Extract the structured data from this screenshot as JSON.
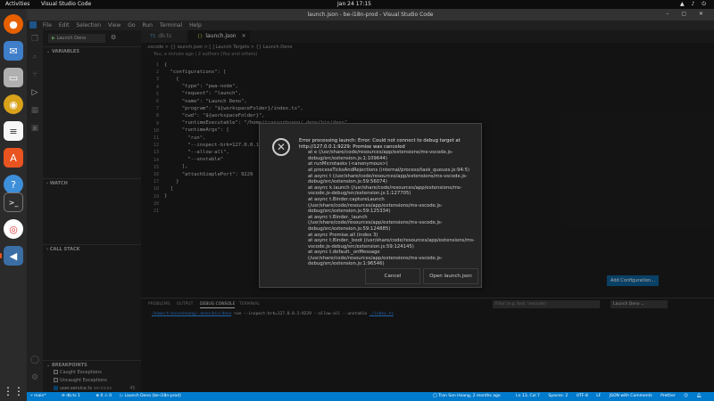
{
  "os": {
    "activities": "Activities",
    "app_name": "Visual Studio Code",
    "clock": "Jan 24  17:15"
  },
  "window": {
    "title": "launch.json - be-i18n-prod - Visual Studio Code"
  },
  "menu": [
    "File",
    "Edit",
    "Selection",
    "View",
    "Go",
    "Run",
    "Terminal",
    "Help"
  ],
  "sidebar": {
    "run_config": "Launch Deno",
    "sections": {
      "variables": "VARIABLES",
      "watch": "WATCH",
      "call_stack": "CALL STACK",
      "breakpoints": "BREAKPOINTS"
    },
    "breakpoints": [
      {
        "label": "Caught Exceptions",
        "checked": false
      },
      {
        "label": "Uncaught Exceptions",
        "checked": false
      },
      {
        "label": "user.service.ts",
        "detail": "services",
        "count": "45",
        "checked": true
      }
    ]
  },
  "tabs": [
    {
      "label": "db.ts",
      "active": false
    },
    {
      "label": "launch.json",
      "active": true
    }
  ],
  "breadcrumb": ".vscode  >  {} launch.json  >  [ ] Launch Targets  >  {} Launch Deno",
  "blame": "You, a minute ago | 2 authors (You and others)",
  "code_lines": [
    {
      "n": "1",
      "t": "{"
    },
    {
      "n": "2",
      "t": "  \"configurations\": ["
    },
    {
      "n": "3",
      "t": "    {"
    },
    {
      "n": "4",
      "t": "      \"type\": \"pwa-node\","
    },
    {
      "n": "5",
      "t": "      \"request\": \"launch\","
    },
    {
      "n": "6",
      "t": "      \"name\": \"Launch Deno\","
    },
    {
      "n": "7",
      "t": "      \"program\": \"${workspaceFolder}/index.ts\","
    },
    {
      "n": "8",
      "t": "      \"cwd\": \"${workspaceFolder}\","
    },
    {
      "n": "9",
      "t": "      \"runtimeExecutable\": \"/home/transonhoang/.deno/bin/deno\","
    },
    {
      "n": "10",
      "t": "      \"runtimeArgs\": ["
    },
    {
      "n": "11",
      "t": "        \"run\","
    },
    {
      "n": "12",
      "t": "        \"--inspect-brk=127.0.0.1:9229\","
    },
    {
      "n": "13",
      "t": "        \"--allow-all\","
    },
    {
      "n": "14",
      "t": "        \"--unstable\""
    },
    {
      "n": "15",
      "t": "      ],"
    },
    {
      "n": "16",
      "t": "      \"attachSimplePort\": 9229"
    },
    {
      "n": "17",
      "t": "    }"
    },
    {
      "n": "18",
      "t": "  ]"
    },
    {
      "n": "19",
      "t": "}"
    },
    {
      "n": "20",
      "t": ""
    },
    {
      "n": "21",
      "t": ""
    }
  ],
  "add_config_button": "Add Configuration...",
  "panel": {
    "tabs": [
      "PROBLEMS",
      "OUTPUT",
      "DEBUG CONSOLE",
      "TERMINAL"
    ],
    "active_tab": "DEBUG CONSOLE",
    "filter_placeholder": "Filter (e.g. text, !exclude)",
    "select_value": "Launch Deno",
    "console_path": "/home/transonhoang/.deno/bin/deno",
    "console_rest": " run --inspect-brk=127.0.0.1:9229 --allow-all --unstable ",
    "console_file": "./index.ts"
  },
  "status": {
    "branch": "main*",
    "sync": "db.ts 1",
    "problems": "⊗ 0  ⚠ 0",
    "debug": "Launch Deno (be-i18n-prod)",
    "author": "Tran Son Hoang, 2 months ago",
    "position": "Ln 13, Col 7",
    "spaces": "Spaces: 2",
    "encoding": "UTF-8",
    "eol": "LF",
    "language": "JSON with Comments",
    "prettier": "Prettier"
  },
  "dialog": {
    "lines": [
      "Error processing launch: Error: Could not connect to debug target at http://127.0.0.1:9229: Promise was canceled",
      "at e (/usr/share/code/resources/app/extensions/ms-vscode.js-debug/src/extension.js:1:109644)",
      "at runMicrotasks (<anonymous>)",
      "at processTicksAndRejections (internal/process/task_queues.js:94:5)",
      "at async t (/usr/share/code/resources/app/extensions/ms-vscode.js-debug/src/extension.js:59:56074)",
      "at async k.launch (/usr/share/code/resources/app/extensions/ms-vscode.js-debug/src/extension.js:1:127705)",
      "at async t.Binder.captureLaunch (/usr/share/code/resources/app/extensions/ms-vscode.js-debug/src/extension.js:59:125334)",
      "at async t.Binder._launch (/usr/share/code/resources/app/extensions/ms-vscode.js-debug/src/extension.js:59:124885)",
      "at async Promise.all (index 3)",
      "at async t.Binder._boot (/usr/share/code/resources/app/extensions/ms-vscode.js-debug/src/extension.js:59:124145)",
      "at async t.default._onMessage (/usr/share/code/resources/app/extensions/ms-vscode.js-debug/src/extension.js:1:96546)"
    ],
    "cancel": "Cancel",
    "open": "Open launch.json"
  },
  "colors": {
    "accent": "#007acc",
    "error": "#f48771"
  }
}
